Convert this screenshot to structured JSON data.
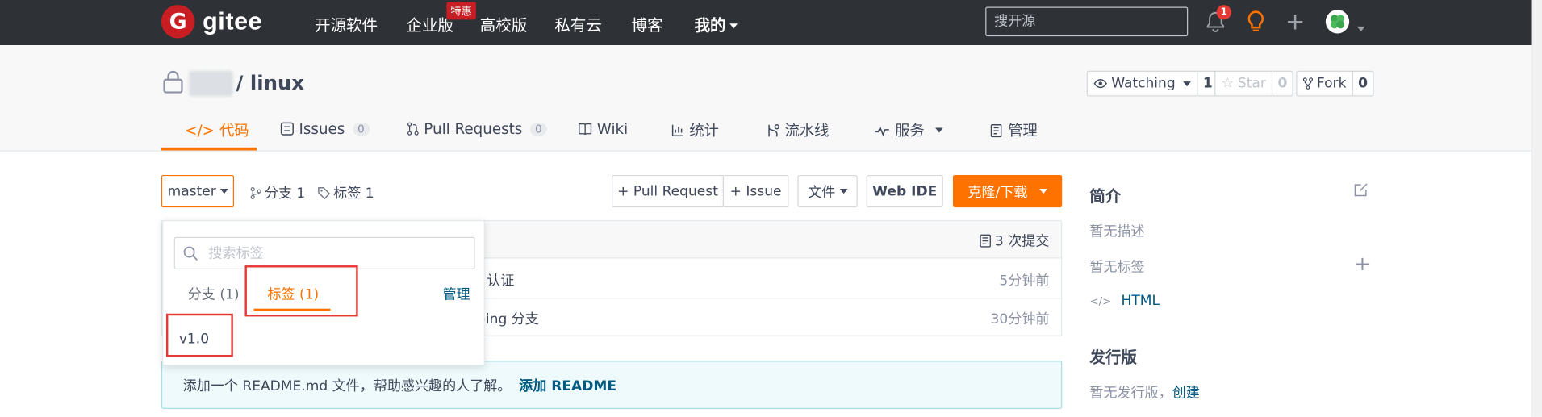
{
  "nav": {
    "logo_letter": "G",
    "logo_text": "gitee",
    "items": [
      "开源软件",
      "企业版",
      "高校版",
      "私有云",
      "博客",
      "我的"
    ],
    "enterprise_badge": "特惠",
    "search_placeholder": "搜开源",
    "notification_count": "1",
    "icons": [
      "bell-icon",
      "lightbulb-icon",
      "plus-icon",
      "avatar-icon"
    ]
  },
  "repo": {
    "name": "linux",
    "separator": "/",
    "watch_label": "Watching",
    "watch_count": "1",
    "star_label": "Star",
    "star_count": "0",
    "fork_label": "Fork",
    "fork_count": "0"
  },
  "tabs": [
    {
      "label": "代码",
      "icon": "code-icon"
    },
    {
      "label": "Issues",
      "count": "0",
      "icon": "issues-icon"
    },
    {
      "label": "Pull Requests",
      "count": "0",
      "icon": "pull-request-icon"
    },
    {
      "label": "Wiki",
      "icon": "book-icon"
    },
    {
      "label": "统计",
      "icon": "bar-chart-icon"
    },
    {
      "label": "流水线",
      "icon": "pipeline-icon"
    },
    {
      "label": "服务",
      "icon": "pulse-icon"
    },
    {
      "label": "管理",
      "icon": "settings-doc-icon"
    }
  ],
  "toolbar": {
    "branch": "master",
    "branches_label": "分支 1",
    "tags_label": "标签 1",
    "pull_request_btn": "+ Pull Request",
    "issue_btn": "+ Issue",
    "file_btn": "文件",
    "webide_btn": "Web IDE",
    "clone_btn": "克隆/下载"
  },
  "commits": {
    "count_label": "3 次提交",
    "rows": [
      {
        "message_tail": "认证",
        "time": "5分钟前"
      },
      {
        "message_tail": "ping 分支",
        "time": "30分钟前"
      }
    ]
  },
  "readme": {
    "text": "添加一个 README.md 文件，帮助感兴趣的人了解。",
    "link": "添加 README"
  },
  "dropdown": {
    "search_placeholder": "搜索标签",
    "tab_branches": "分支 (1)",
    "tab_tags": "标签 (1)",
    "manage": "管理",
    "items": [
      "v1.0"
    ]
  },
  "sidebar": {
    "intro_title": "简介",
    "no_desc": "暂无描述",
    "no_tags": "暂无标签",
    "language": "HTML",
    "release_title": "发行版",
    "no_release": "暂无发行版，",
    "create_link": "创建"
  },
  "colors": {
    "nav_bg": "#2e3237",
    "accent": "#fe7300",
    "brand_red": "#c71d23",
    "link": "#005980",
    "highlight_box": "#e53935"
  }
}
